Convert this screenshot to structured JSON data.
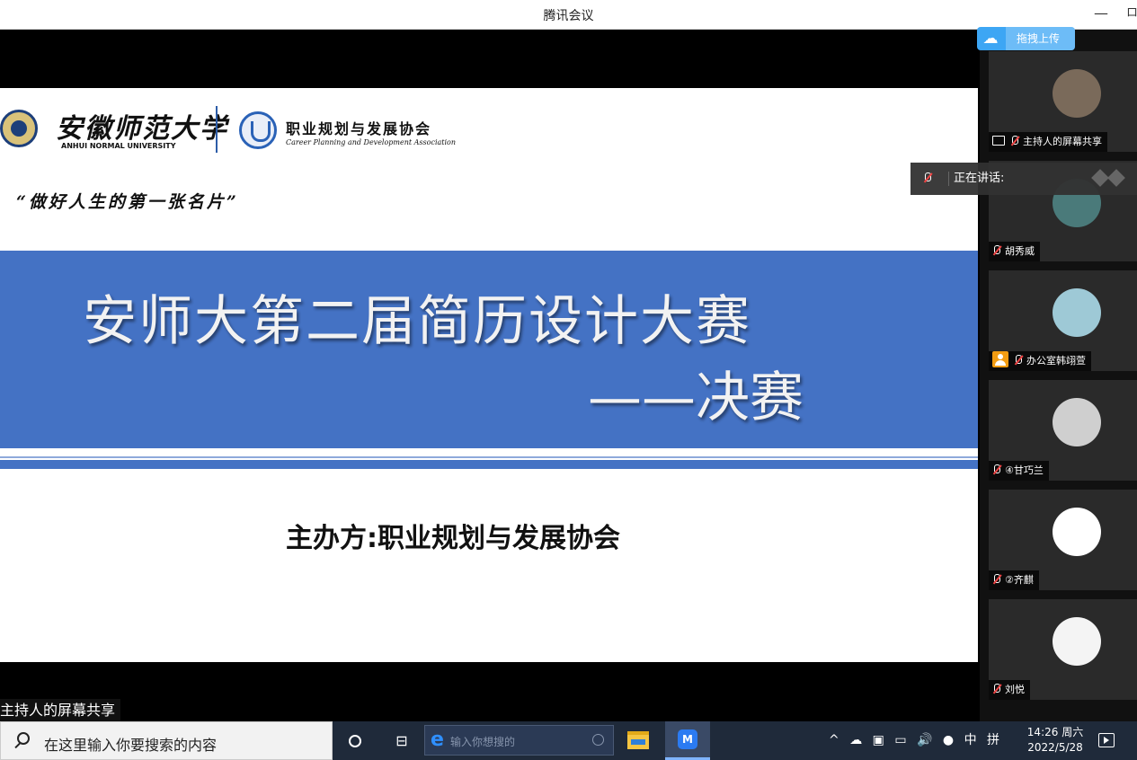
{
  "window": {
    "title": "腾讯会议",
    "minimize": "—",
    "restore": "ロ"
  },
  "slide": {
    "university_cn": "安徽师范大学",
    "university_en": "ANHUI NORMAL UNIVERSITY",
    "association_cn": "职业规划与发展协会",
    "association_en": "Career Planning and Development Association",
    "motto": "“做好人生的第一张名片”",
    "title_line1": "安师大第二届简历设计大赛",
    "title_line2": "——决赛",
    "organizer": "主办方:职业规划与发展协会"
  },
  "share_label": "主持人的屏幕共享",
  "upload_button": "拖拽上传",
  "speaking": {
    "label": "正在讲话:"
  },
  "participants": [
    {
      "name": "主持人的屏幕共享",
      "avatar_color": "#7a6a5a"
    },
    {
      "name": "胡秀威",
      "avatar_color": "#4a7a7a"
    },
    {
      "name": "办公室韩翊萱",
      "avatar_color": "#9ec9d6"
    },
    {
      "name": "④甘巧兰",
      "avatar_color": "#cfcfcf"
    },
    {
      "name": "②齐麒",
      "avatar_color": "#ffffff"
    },
    {
      "name": "刘悦",
      "avatar_color": "#f4f4f4"
    }
  ],
  "taskbar": {
    "search_placeholder": "在这里输入你要搜索的内容",
    "browser_placeholder": "输入你想搜的",
    "meeting_icon_text": "M",
    "tray_up": "^",
    "tray_cloud": "☁",
    "tray_volume": "🔊",
    "tray_ime": "中",
    "tray_grid": "拼",
    "time": "14:26 周六",
    "date": "2022/5/28"
  }
}
